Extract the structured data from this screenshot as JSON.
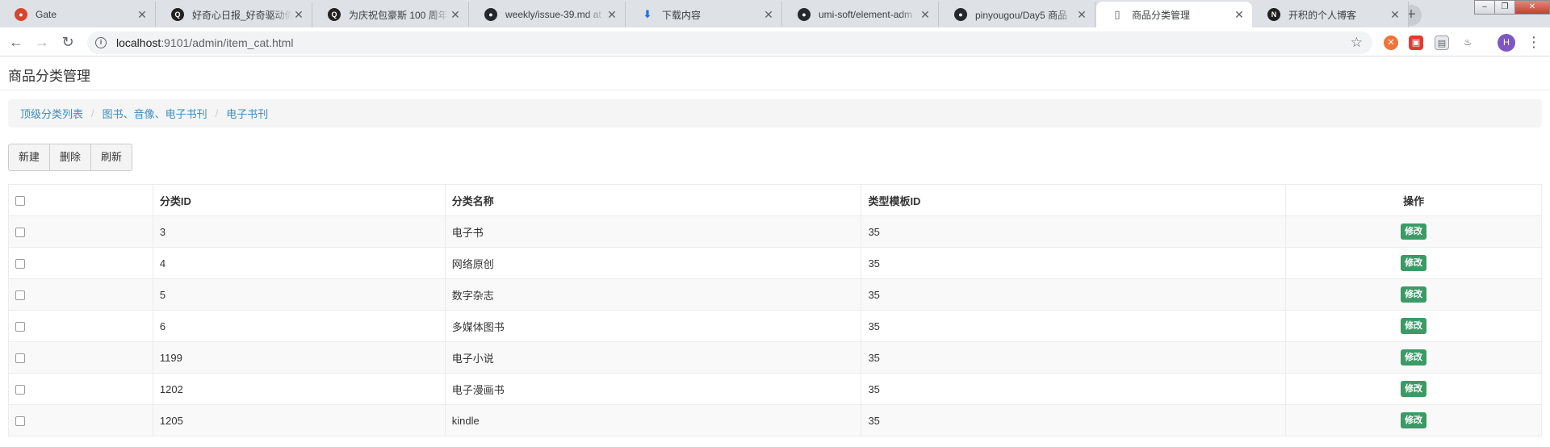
{
  "browser": {
    "tabs": [
      {
        "title": "Gate",
        "icon": "gate-icon",
        "color": "#d6462f",
        "active": false
      },
      {
        "title": "好奇心日报_好奇驱动你",
        "icon": "qdaily-icon",
        "color": "#222222",
        "active": false
      },
      {
        "title": "为庆祝包豪斯 100 周年",
        "icon": "qdaily-icon",
        "color": "#222222",
        "active": false
      },
      {
        "title": "weekly/issue-39.md at",
        "icon": "github-icon",
        "color": "#24292e",
        "active": false
      },
      {
        "title": "下载内容",
        "icon": "download-icon",
        "color": "#1a73e8",
        "active": false
      },
      {
        "title": "umi-soft/element-adm",
        "icon": "github-icon",
        "color": "#24292e",
        "active": false
      },
      {
        "title": "pinyougou/Day5 商品",
        "icon": "github-icon",
        "color": "#24292e",
        "active": false
      },
      {
        "title": "商品分类管理",
        "icon": "page-icon",
        "color": "#5f6368",
        "active": true
      },
      {
        "title": "开积的个人博客",
        "icon": "notion-icon",
        "color": "#1f1f1f",
        "active": false
      }
    ],
    "url_host": "localhost",
    "url_path": ":9101/admin/item_cat.html",
    "profile_initial": "H"
  },
  "page": {
    "title": "商品分类管理",
    "breadcrumb": [
      "顶级分类列表",
      "图书、音像、电子书刊",
      "电子书刊"
    ],
    "toolbar": {
      "new_label": "新建",
      "delete_label": "删除",
      "refresh_label": "刷新"
    },
    "table": {
      "headers": {
        "id": "分类ID",
        "name": "分类名称",
        "template": "类型模板ID",
        "ops": "操作"
      },
      "edit_label": "修改",
      "rows": [
        {
          "id": "3",
          "name": "电子书",
          "template": "35"
        },
        {
          "id": "4",
          "name": "网络原创",
          "template": "35"
        },
        {
          "id": "5",
          "name": "数字杂志",
          "template": "35"
        },
        {
          "id": "6",
          "name": "多媒体图书",
          "template": "35"
        },
        {
          "id": "1199",
          "name": "电子小说",
          "template": "35"
        },
        {
          "id": "1202",
          "name": "电子漫画书",
          "template": "35"
        },
        {
          "id": "1205",
          "name": "kindle",
          "template": "35"
        }
      ]
    }
  }
}
